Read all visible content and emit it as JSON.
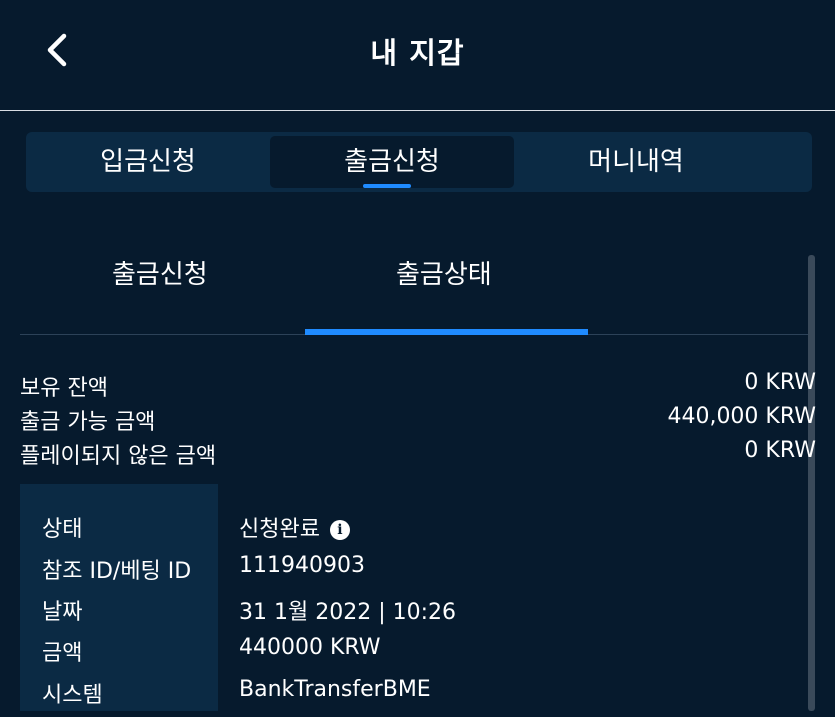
{
  "header": {
    "title": "내 지갑",
    "back_icon": "chevron-left-icon"
  },
  "tabs": [
    {
      "label": "입금신청",
      "active": false
    },
    {
      "label": "출금신청",
      "active": true
    },
    {
      "label": "머니내역",
      "active": false
    }
  ],
  "subtabs": [
    {
      "label": "출금신청",
      "active": false
    },
    {
      "label": "출금상태",
      "active": true
    }
  ],
  "balances": [
    {
      "label": "보유 잔액",
      "value": "0 KRW"
    },
    {
      "label": "출금 가능 금액",
      "value": "440,000 KRW"
    },
    {
      "label": "플레이되지 않은 금액",
      "value": "0 KRW"
    }
  ],
  "details": [
    {
      "key": "상태",
      "value": "신청완료"
    },
    {
      "key": "참조 ID/베팅 ID",
      "value": "111940903"
    },
    {
      "key": "날짜",
      "value": "31 1월 2022 | 10:26"
    },
    {
      "key": "금액",
      "value": "440000 KRW"
    },
    {
      "key": "시스템",
      "value": "BankTransferBME"
    }
  ],
  "info_icon_glyph": "i",
  "colors": {
    "background": "#061a2d",
    "panel": "#0b2a44",
    "accent": "#1f8bff"
  }
}
